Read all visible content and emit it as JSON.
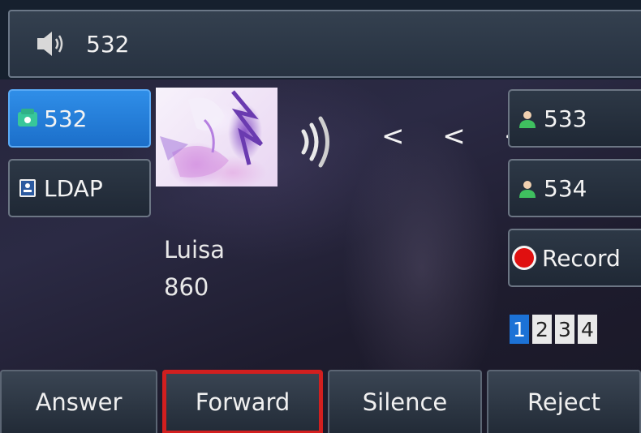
{
  "header": {
    "title": "532",
    "icon": "speaker-icon"
  },
  "left_keys": [
    {
      "label": "532",
      "icon": "phone-icon",
      "active": true
    },
    {
      "label": "LDAP",
      "icon": "directory-icon",
      "active": false
    }
  ],
  "right_keys": [
    {
      "label": "533",
      "icon": "contact-icon"
    },
    {
      "label": "534",
      "icon": "contact-icon"
    },
    {
      "label": "Record",
      "icon": "record-icon"
    }
  ],
  "caller": {
    "name": "Luisa",
    "number": "860",
    "avatar": "caller-avatar"
  },
  "call_indicator": {
    "icons": [
      "ringing-signal-icon",
      "incoming-arrows-icon"
    ],
    "arrows": "< < <"
  },
  "pagination": {
    "pages": [
      "1",
      "2",
      "3",
      "4"
    ],
    "current": "1"
  },
  "softkeys": [
    {
      "label": "Answer"
    },
    {
      "label": "Forward",
      "highlighted": true
    },
    {
      "label": "Silence"
    },
    {
      "label": "Reject"
    }
  ],
  "colors": {
    "active_blue": "#1c72d6",
    "highlight_red": "#d21f1f",
    "record_red": "#e01010"
  }
}
